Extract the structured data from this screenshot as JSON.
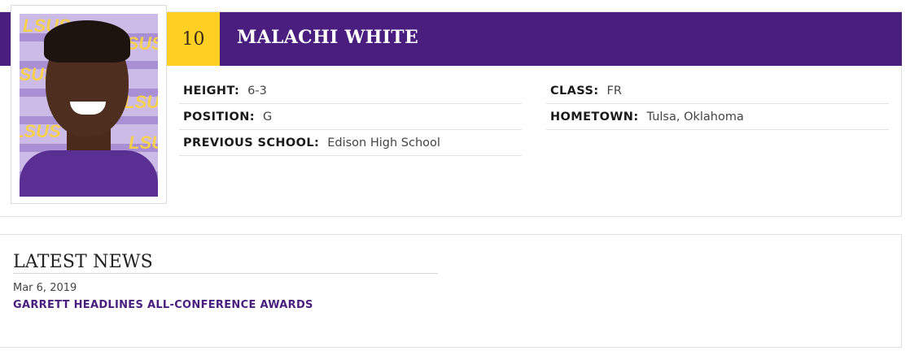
{
  "player": {
    "number": "10",
    "name": "MALACHI WHITE",
    "photo_watermark": "LSUS",
    "details_left": [
      {
        "label": "HEIGHT:",
        "value": "6-3"
      },
      {
        "label": "POSITION:",
        "value": "G"
      },
      {
        "label": "PREVIOUS SCHOOL:",
        "value": "Edison High School"
      }
    ],
    "details_right": [
      {
        "label": "CLASS:",
        "value": "FR"
      },
      {
        "label": "HOMETOWN:",
        "value": "Tulsa, Oklahoma"
      }
    ]
  },
  "news": {
    "title": "LATEST NEWS",
    "items": [
      {
        "date": "Mar 6, 2019",
        "headline": "GARRETT HEADLINES ALL-CONFERENCE AWARDS"
      }
    ]
  },
  "colors": {
    "brand_purple": "#4a1e7e",
    "brand_gold": "#fdd023"
  }
}
